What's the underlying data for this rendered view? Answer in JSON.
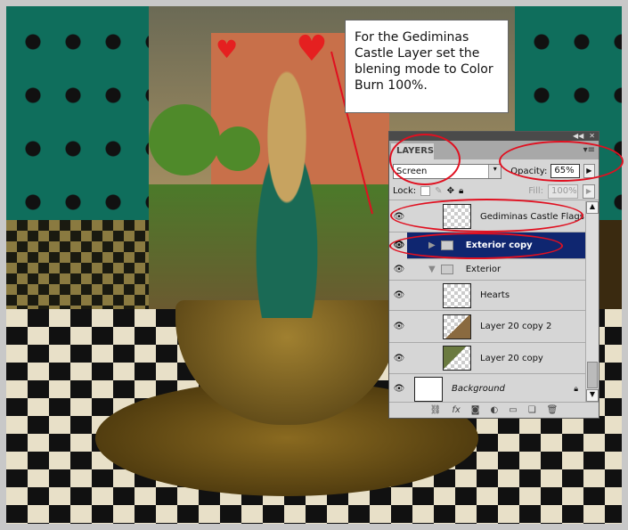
{
  "callout": {
    "text": "For the Gediminas Castle Layer set the blening mode to Color Burn 100%."
  },
  "panel": {
    "tab": "LAYERS",
    "blend_mode": "Screen",
    "opacity_label": "Opacity:",
    "opacity_value": "65%",
    "lock_label": "Lock:",
    "fill_label": "Fill:",
    "fill_value": "100%",
    "layers": [
      {
        "name": "Gediminas Castle Flags",
        "type": "layer",
        "visible": true
      },
      {
        "name": "Exterior copy",
        "type": "group-collapsed",
        "visible": true,
        "selected": true
      },
      {
        "name": "Exterior",
        "type": "group-expanded",
        "visible": true
      },
      {
        "name": "Hearts",
        "type": "layer",
        "visible": true
      },
      {
        "name": "Layer 20 copy 2",
        "type": "layer",
        "visible": true
      },
      {
        "name": "Layer 20 copy",
        "type": "layer",
        "visible": true
      },
      {
        "name": "Background",
        "type": "background",
        "visible": true,
        "locked": true
      }
    ]
  },
  "colors": {
    "selected_row": "#0f2670",
    "annotation": "#e01020"
  }
}
